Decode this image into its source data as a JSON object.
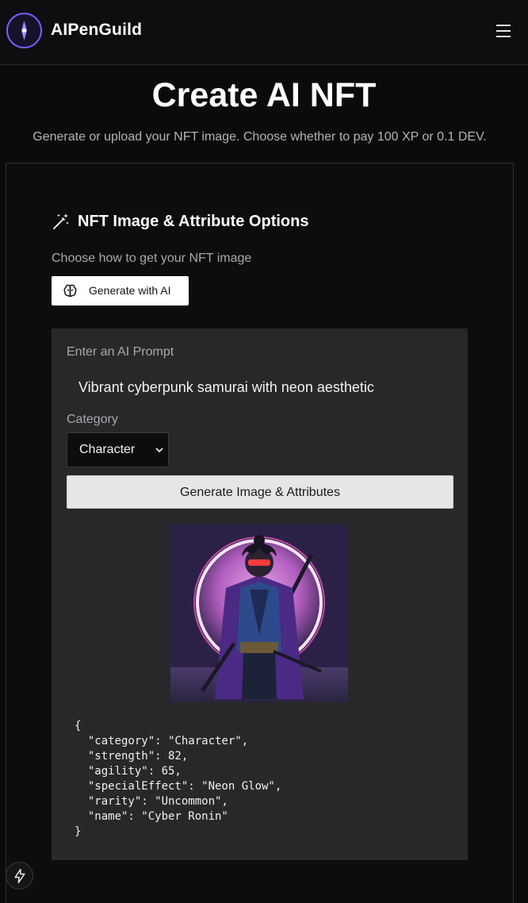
{
  "header": {
    "brand": "AIPenGuild",
    "logo_icon": "compass-icon",
    "menu_icon": "hamburger-menu-icon"
  },
  "page": {
    "title": "Create AI NFT",
    "subtitle": "Generate or upload your NFT image. Choose whether to pay 100 XP or 0.1 DEV."
  },
  "options": {
    "section_title": "NFT Image & Attribute Options",
    "section_icon": "magic-wand-icon",
    "choose_label": "Choose how to get your NFT image",
    "generate_ai_button": "Generate with AI",
    "generate_ai_icon": "brain-icon"
  },
  "form": {
    "prompt_label": "Enter an AI Prompt",
    "prompt_value": "Vibrant cyberpunk samurai with neon aesthetic",
    "category_label": "Category",
    "category_value": "Character",
    "generate_button": "Generate Image & Attributes"
  },
  "result": {
    "json_lines": [
      "{",
      "  \"category\": \"Character\",",
      "  \"strength\": 82,",
      "  \"agility\": 65,",
      "  \"specialEffect\": \"Neon Glow\",",
      "  \"rarity\": \"Uncommon\",",
      "  \"name\": \"Cyber Ronin\"",
      "}"
    ]
  },
  "floating": {
    "bolt_icon": "lightning-bolt-icon"
  },
  "colors": {
    "accent": "#7b5cff",
    "background": "#0b0b0c",
    "panel": "#28282a"
  }
}
